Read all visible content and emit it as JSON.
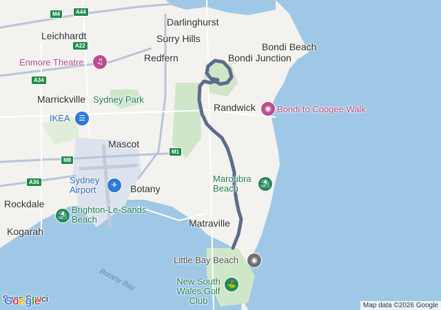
{
  "map": {
    "colors": {
      "water": "#9fc8e6",
      "land": "#f3f2ee",
      "park": "#cfe6c9",
      "airport": "#dde3ee",
      "route": "#5d6b8c",
      "road": "#ffffff",
      "highway": "#b8c4da"
    },
    "suburbs": {
      "darlinghurst": "Darlinghurst",
      "leichhardt": "Leichhardt",
      "surry_hills": "Surry Hills",
      "redfern": "Redfern",
      "bondi_junction": "Bondi Junction",
      "bondi_beach": "Bondi Beach",
      "marrickville": "Marrickville",
      "randwick": "Randwick",
      "mascot": "Mascot",
      "botany": "Botany",
      "rockdale": "Rockdale",
      "kogarah": "Kogarah",
      "matraville": "Matraville",
      "sans_souci": "Sans Souci"
    },
    "places": {
      "enmore": "Enmore Theatre",
      "sydney_park": "Sydney Park",
      "ikea": "IKEA",
      "bondi_coogee": "Bondi to Coogee Walk",
      "sydney_airport": "Sydney Airport",
      "maroubra": "Maroubra Beach",
      "brighton": "Brighton-Le-Sands Beach",
      "little_bay": "Little Bay Beach",
      "nsw_golf": "New South Wales Golf Club"
    },
    "water": {
      "botany_bay": "Botany Bay"
    },
    "shields": {
      "m4": "M4",
      "a44": "A44",
      "a22": "A22",
      "a34": "A34",
      "m8": "M8",
      "a36": "A36",
      "m1": "M1"
    },
    "icons": {
      "theatre": "theatre-icon",
      "park": "park-icon",
      "shopping": "shopping-icon",
      "airport": "airport-icon",
      "beach": "beach-icon",
      "golf": "golf-icon",
      "place": "place-icon"
    },
    "attribution": "Map data ©2026 Google",
    "logo": "Google"
  }
}
